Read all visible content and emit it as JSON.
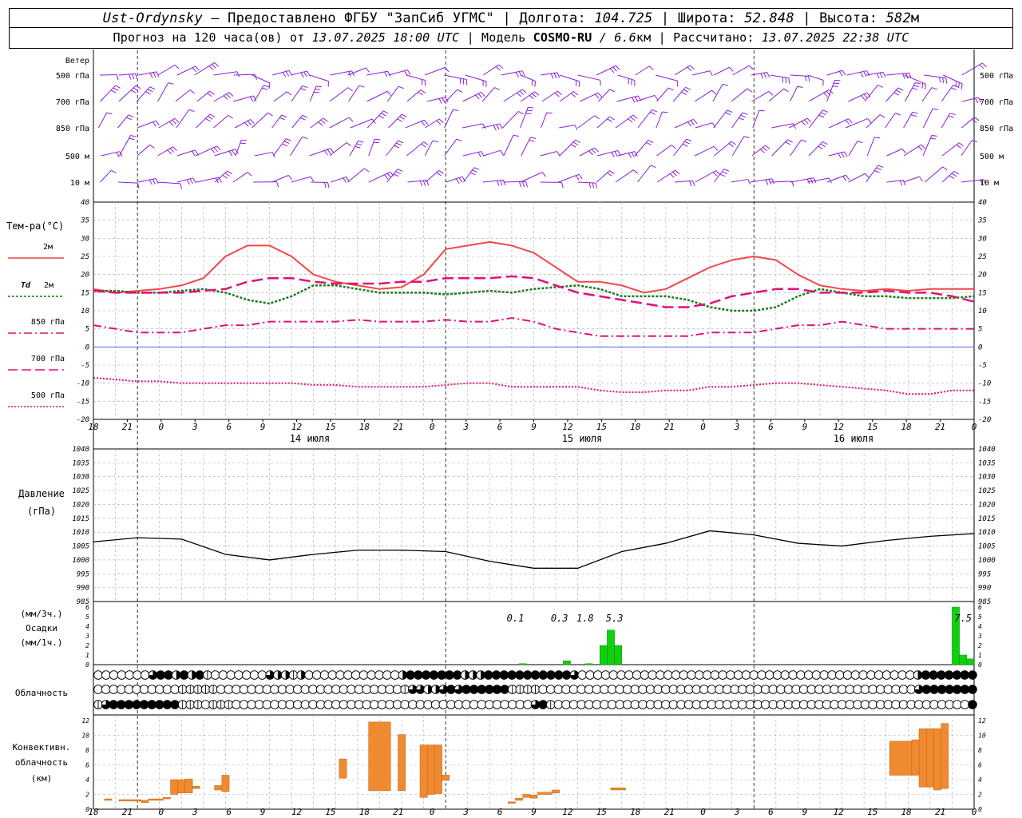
{
  "header": {
    "station": "Ust-Ordynsky",
    "provider": "— Предоставлено ФГБУ \"ЗапСиб УГМС\"",
    "lon_label": "Долгота:",
    "lon": "104.725",
    "lat_label": "Широта:",
    "lat": "52.848",
    "alt_label": "Высота:",
    "alt": "582",
    "alt_unit": "м",
    "forecast_label": "Прогноз на 120 часа(ов) от",
    "forecast_time": "13.07.2025 18:00 UTC",
    "model_label": "Модель",
    "model": "COSMO-RU",
    "model_res": "/ 6.6",
    "model_res_unit": "км",
    "computed_label": "Рассчитано:",
    "computed_time": "13.07.2025 22:38 UTC"
  },
  "panels": {
    "wind": {
      "title": "Ветер",
      "levels": [
        "500 гПа",
        "700 гПа",
        "850 гПа",
        "500 м",
        "10 м"
      ]
    },
    "temp": {
      "title": "Тем-ра(°C)",
      "legend": [
        {
          "name": "2м",
          "pre": "",
          "color": "#f04040",
          "dash": ""
        },
        {
          "name": "2м",
          "pre": "Td",
          "color": "#1a7a1a",
          "dash": "3,2"
        },
        {
          "name": "850 гПа",
          "pre": "",
          "color": "#e0107a",
          "dash": "10,4,2,4"
        },
        {
          "name": "700 гПа",
          "pre": "",
          "color": "#e0107a",
          "dash": "12,5"
        },
        {
          "name": "500 гПа",
          "pre": "",
          "color": "#e0107a",
          "dash": "2,2"
        }
      ]
    },
    "pressure": {
      "title": "Давление",
      "unit": "(гПа)"
    },
    "precip": {
      "unit1": "(мм/3ч.)",
      "title": "Осадки",
      "unit2": "(мм/1ч.)"
    },
    "cloud": {
      "title": "Облачность"
    },
    "conv": {
      "line1": "Конвективн.",
      "line2": "облачность",
      "line3": "(км)"
    }
  },
  "axis": {
    "hour_labels": [
      "18",
      "21",
      "0",
      "3",
      "6",
      "9",
      "12",
      "15",
      "18",
      "21",
      "0",
      "3",
      "6",
      "9",
      "12",
      "15",
      "18",
      "21",
      "0",
      "3",
      "6",
      "9",
      "12",
      "15",
      "18",
      "21",
      "0"
    ],
    "days": [
      "14 июля",
      "15 июля",
      "16 июля"
    ]
  },
  "chart_data": [
    {
      "type": "line",
      "title": "Тем-ра(°C)",
      "x_hours": [
        0,
        3,
        6,
        9,
        12,
        15,
        18,
        21,
        24,
        27,
        30,
        33,
        36,
        39,
        42,
        45,
        48,
        51,
        54,
        57,
        60,
        63,
        66,
        69,
        72,
        75,
        78,
        81,
        84,
        87,
        90,
        93,
        96,
        99,
        102,
        105,
        108,
        111,
        114,
        117,
        120
      ],
      "ylim": [
        -20,
        40
      ],
      "yticks": [
        -20,
        -15,
        -10,
        -5,
        0,
        5,
        10,
        15,
        20,
        25,
        30,
        35,
        40
      ],
      "series": [
        {
          "name": "2м",
          "values": [
            16,
            15,
            15.5,
            16,
            17,
            19,
            25,
            28,
            28,
            25,
            20,
            18,
            17,
            16,
            16.5,
            20,
            27,
            28,
            29,
            28,
            26,
            22,
            18,
            18,
            17,
            15,
            16,
            19,
            22,
            24,
            25,
            24,
            20,
            17,
            16,
            15.5,
            16,
            15.5,
            16,
            16,
            16
          ]
        },
        {
          "name": "Td 2м",
          "values": [
            15.5,
            15.5,
            15,
            15,
            15.5,
            16,
            15,
            13,
            12,
            14,
            17,
            17,
            16,
            15,
            15,
            15,
            14.5,
            15,
            15.5,
            15,
            16,
            16.5,
            17,
            16,
            14,
            14,
            14,
            13,
            11,
            10,
            10,
            11,
            14,
            16,
            15,
            14,
            14,
            13.5,
            13.5,
            13.5,
            14
          ]
        },
        {
          "name": "850 гПа",
          "values": [
            6,
            5,
            4,
            4,
            4,
            5,
            6,
            6,
            7,
            7,
            7,
            7,
            7.5,
            7,
            7,
            7,
            7.5,
            7,
            7,
            8,
            7,
            5,
            4,
            3,
            3,
            3,
            3,
            3,
            4,
            4,
            4,
            5,
            6,
            6,
            7,
            6,
            5,
            5,
            5,
            5,
            5
          ]
        },
        {
          "name": "700 гПа",
          "values": [
            15.5,
            15,
            15,
            15,
            15,
            15.5,
            16,
            18,
            19,
            19,
            18,
            17.5,
            17.5,
            17.5,
            18,
            18,
            19,
            19,
            19,
            19.5,
            19,
            17,
            15,
            14,
            13,
            12,
            11,
            11,
            12,
            14,
            15,
            16,
            16,
            15,
            15,
            15,
            15.5,
            15,
            15,
            14,
            12.5
          ]
        },
        {
          "name": "500 гПа",
          "values": [
            -8.5,
            -9,
            -9.5,
            -9.5,
            -10,
            -10,
            -10,
            -10,
            -10,
            -10,
            -10.5,
            -10.5,
            -11,
            -11,
            -11,
            -11,
            -10.5,
            -10,
            -10,
            -11,
            -11,
            -11,
            -11,
            -12,
            -12.5,
            -12.5,
            -12,
            -12,
            -11,
            -11,
            -10.5,
            -10,
            -10,
            -10.5,
            -11,
            -11.5,
            -12,
            -13,
            -13,
            -12,
            -12
          ]
        }
      ]
    },
    {
      "type": "line",
      "title": "Давление",
      "ylabel": "(гПа)",
      "x_hours": [
        0,
        6,
        12,
        18,
        24,
        30,
        36,
        42,
        48,
        54,
        60,
        66,
        72,
        78,
        84,
        90,
        96,
        102,
        108,
        114,
        120
      ],
      "ylim": [
        985,
        1040
      ],
      "yticks": [
        985,
        990,
        995,
        1000,
        1005,
        1010,
        1015,
        1020,
        1025,
        1030,
        1035,
        1040
      ],
      "series": [
        {
          "name": "",
          "values": [
            1006.5,
            1008,
            1007.5,
            1002,
            1000,
            1002,
            1003.5,
            1003.5,
            1003,
            999.5,
            997,
            997,
            1003,
            1006,
            1010.5,
            1009,
            1006,
            1005,
            1007,
            1008.5,
            1009.5
          ]
        }
      ]
    },
    {
      "type": "bar",
      "title": "Осадки",
      "ylabel": "(мм/3ч.) (мм/1ч.)",
      "ylim": [
        0,
        6
      ],
      "yticks": [
        0,
        1,
        2,
        3,
        4,
        5,
        6
      ],
      "bars": [
        {
          "x": 58.5,
          "value": 0.1
        },
        {
          "x": 64.5,
          "value": 0.4
        },
        {
          "x": 67.5,
          "value": 0.1
        },
        {
          "x": 69.5,
          "value": 2
        },
        {
          "x": 70.5,
          "value": 3.6
        },
        {
          "x": 71.5,
          "value": 2
        },
        {
          "x": 117.5,
          "value": 6
        },
        {
          "x": 118.5,
          "value": 1
        },
        {
          "x": 119.5,
          "value": 0.6
        }
      ],
      "annotations": [
        {
          "x": 57.5,
          "label": "0.1"
        },
        {
          "x": 63.5,
          "label": "0.3"
        },
        {
          "x": 67,
          "label": "1.8"
        },
        {
          "x": 71,
          "label": "5.3"
        },
        {
          "x": 118.5,
          "label": "7.5"
        }
      ]
    },
    {
      "type": "bar",
      "title": "Конвективн. облачность",
      "ylabel": "(км)",
      "ylim": [
        0,
        12
      ],
      "yticks": [
        0,
        2,
        4,
        6,
        8,
        10,
        12
      ],
      "segments": [
        {
          "x0": 1.5,
          "x1": 2.5,
          "bottom": 1.2,
          "top": 1.4
        },
        {
          "x0": 3.5,
          "x1": 6.5,
          "bottom": 1.1,
          "top": 1.3
        },
        {
          "x0": 6.5,
          "x1": 7.5,
          "bottom": 0.9,
          "top": 1.2
        },
        {
          "x0": 7.5,
          "x1": 9.5,
          "bottom": 1.2,
          "top": 1.4
        },
        {
          "x0": 9.5,
          "x1": 10.5,
          "bottom": 1.4,
          "top": 1.6
        },
        {
          "x0": 10.5,
          "x1": 11.5,
          "bottom": 2,
          "top": 4
        },
        {
          "x0": 11.5,
          "x1": 12.5,
          "bottom": 2.2,
          "top": 4
        },
        {
          "x0": 12.5,
          "x1": 13.5,
          "bottom": 2.2,
          "top": 4.1
        },
        {
          "x0": 13.5,
          "x1": 14.5,
          "bottom": 2.8,
          "top": 3.1
        },
        {
          "x0": 16.5,
          "x1": 17.5,
          "bottom": 2.6,
          "top": 3.2
        },
        {
          "x0": 17.5,
          "x1": 18.5,
          "bottom": 2.4,
          "top": 4.6
        },
        {
          "x0": 33.5,
          "x1": 34.5,
          "bottom": 4.2,
          "top": 6.8
        },
        {
          "x0": 37.5,
          "x1": 40.5,
          "bottom": 2.5,
          "top": 11.8
        },
        {
          "x0": 41.5,
          "x1": 42.5,
          "bottom": 2.5,
          "top": 10.1
        },
        {
          "x0": 44.5,
          "x1": 45.5,
          "bottom": 1.6,
          "top": 8.7
        },
        {
          "x0": 45.5,
          "x1": 46.5,
          "bottom": 2.0,
          "top": 8.7
        },
        {
          "x0": 46.5,
          "x1": 47.5,
          "bottom": 2.1,
          "top": 8.7
        },
        {
          "x0": 47.5,
          "x1": 48.5,
          "bottom": 3.9,
          "top": 4.6
        },
        {
          "x0": 56.5,
          "x1": 57.5,
          "bottom": 0.8,
          "top": 1.0
        },
        {
          "x0": 57.5,
          "x1": 58.5,
          "bottom": 1.2,
          "top": 1.5
        },
        {
          "x0": 58.5,
          "x1": 59.5,
          "bottom": 1.6,
          "top": 2.0
        },
        {
          "x0": 59.5,
          "x1": 60.5,
          "bottom": 1.5,
          "top": 1.9
        },
        {
          "x0": 60.5,
          "x1": 62.5,
          "bottom": 2.0,
          "top": 2.3
        },
        {
          "x0": 62.5,
          "x1": 63.5,
          "bottom": 2.2,
          "top": 2.6
        },
        {
          "x0": 70.5,
          "x1": 72.5,
          "bottom": 2.6,
          "top": 2.9
        },
        {
          "x0": 108.5,
          "x1": 111.5,
          "bottom": 4.6,
          "top": 9.2
        },
        {
          "x0": 111.5,
          "x1": 112.5,
          "bottom": 4.6,
          "top": 9.4
        },
        {
          "x0": 112.5,
          "x1": 113.5,
          "bottom": 3.0,
          "top": 10.9
        },
        {
          "x0": 113.5,
          "x1": 114.5,
          "bottom": 3.0,
          "top": 10.9
        },
        {
          "x0": 114.5,
          "x1": 115.5,
          "bottom": 2.6,
          "top": 10.9
        },
        {
          "x0": 115.5,
          "x1": 116.5,
          "bottom": 2.8,
          "top": 11.6
        }
      ]
    },
    {
      "type": "table",
      "title": "Облачность",
      "rows_note": "cloud cover symbols per 3-hour step, 0=clear 1=quarter 2=half 3=three-quarter 4=overcast",
      "rows": [
        [
          0,
          0,
          0,
          0,
          0,
          0,
          0,
          3,
          4,
          4,
          2,
          4,
          2,
          4,
          1,
          0,
          0,
          0,
          0,
          0,
          0,
          0,
          3,
          2,
          2,
          1,
          2,
          0,
          0,
          0,
          0,
          0,
          0,
          0,
          0,
          0,
          0,
          0,
          0,
          2,
          4,
          4,
          4,
          4,
          4,
          4,
          4,
          2,
          2,
          2,
          4,
          4,
          4,
          4,
          4,
          4,
          4,
          4,
          4,
          4,
          4,
          3,
          0,
          0,
          0,
          0,
          0,
          0,
          0,
          0,
          0,
          0,
          0,
          0,
          0,
          0,
          0,
          0,
          0,
          0,
          0,
          0,
          0,
          0,
          0,
          0,
          0,
          0,
          0,
          0,
          0,
          0,
          0,
          0,
          0,
          0,
          0,
          0,
          0,
          0,
          0,
          0,
          0,
          0,
          0,
          2,
          4,
          4,
          4,
          4,
          4,
          4,
          4
        ],
        [
          0,
          0,
          0,
          0,
          0,
          0,
          0,
          0,
          0,
          0,
          0,
          1,
          1,
          1,
          1,
          1,
          0,
          0,
          0,
          0,
          0,
          0,
          0,
          0,
          0,
          0,
          0,
          0,
          0,
          0,
          0,
          0,
          0,
          0,
          0,
          0,
          0,
          0,
          0,
          0,
          1,
          3,
          3,
          2,
          2,
          3,
          4,
          3,
          4,
          4,
          4,
          4,
          4,
          4,
          1,
          1,
          1,
          1,
          0,
          0,
          0,
          0,
          0,
          0,
          0,
          0,
          0,
          0,
          0,
          0,
          0,
          0,
          0,
          0,
          0,
          0,
          0,
          0,
          0,
          0,
          0,
          0,
          0,
          0,
          0,
          0,
          0,
          0,
          0,
          0,
          0,
          0,
          0,
          0,
          0,
          0,
          0,
          0,
          0,
          0,
          0,
          0,
          0,
          0,
          0,
          0,
          0,
          3,
          4,
          4,
          4,
          4,
          4,
          4,
          4
        ],
        [
          1,
          3,
          4,
          4,
          4,
          4,
          4,
          4,
          4,
          4,
          4,
          1,
          1,
          1,
          0,
          1,
          1,
          1,
          0,
          0,
          0,
          0,
          0,
          0,
          0,
          0,
          0,
          0,
          0,
          0,
          0,
          0,
          0,
          0,
          0,
          0,
          0,
          0,
          0,
          0,
          0,
          0,
          0,
          0,
          0,
          0,
          0,
          0,
          0,
          0,
          0,
          0,
          0,
          0,
          0,
          0,
          0,
          3,
          4,
          1,
          0,
          0,
          0,
          0,
          0,
          0,
          0,
          0,
          0,
          0,
          0,
          0,
          0,
          0,
          0,
          0,
          0,
          0,
          0,
          0,
          0,
          0,
          0,
          0,
          0,
          0,
          0,
          0,
          0,
          0,
          0,
          0,
          0,
          0,
          0,
          0,
          0,
          0,
          0,
          0,
          0,
          0,
          0,
          0,
          0,
          0,
          0,
          0,
          0,
          0,
          0,
          0,
          0,
          0,
          4
        ]
      ]
    }
  ]
}
